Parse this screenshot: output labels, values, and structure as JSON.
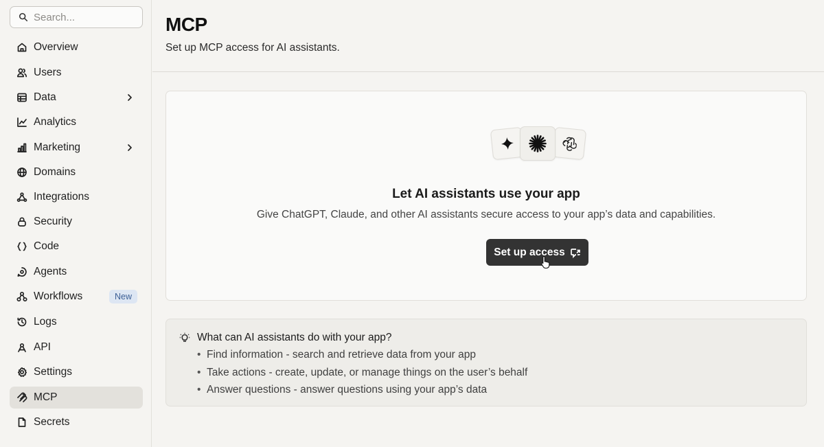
{
  "search": {
    "placeholder": "Search..."
  },
  "sidebar": {
    "items": [
      {
        "label": "Overview",
        "icon": "home-icon"
      },
      {
        "label": "Users",
        "icon": "users-icon"
      },
      {
        "label": "Data",
        "icon": "database-icon",
        "has_submenu": true
      },
      {
        "label": "Analytics",
        "icon": "chart-line-icon"
      },
      {
        "label": "Marketing",
        "icon": "bar-chart-icon",
        "has_submenu": true
      },
      {
        "label": "Domains",
        "icon": "globe-icon"
      },
      {
        "label": "Integrations",
        "icon": "integrations-icon"
      },
      {
        "label": "Security",
        "icon": "lock-icon"
      },
      {
        "label": "Code",
        "icon": "code-braces-icon"
      },
      {
        "label": "Agents",
        "icon": "agent-icon"
      },
      {
        "label": "Workflows",
        "icon": "workflow-icon",
        "badge": "New"
      },
      {
        "label": "Logs",
        "icon": "history-icon"
      },
      {
        "label": "API",
        "icon": "api-icon"
      },
      {
        "label": "Settings",
        "icon": "gear-icon"
      },
      {
        "label": "MCP",
        "icon": "mcp-icon",
        "active": true
      },
      {
        "label": "Secrets",
        "icon": "file-icon"
      }
    ]
  },
  "header": {
    "title": "MCP",
    "subtitle": "Set up MCP access for AI assistants."
  },
  "card": {
    "title": "Let AI assistants use your app",
    "description": "Give ChatGPT, Claude, and other AI assistants secure access to your app’s data and capabilities.",
    "button_label": "Set up access",
    "logos": [
      "gemini-icon",
      "claude-icon",
      "openai-icon"
    ]
  },
  "info": {
    "title": "What can AI assistants do with your app?",
    "items": [
      "Find information - search and retrieve data from your app",
      "Take actions - create, update, or manage things on the user’s behalf",
      "Answer questions - answer questions using your app’s data"
    ]
  },
  "colors": {
    "background": "#f5f4f1",
    "active_item": "#e3e1dc",
    "button": "#333333",
    "badge_bg": "#dde6f3",
    "badge_text": "#3c5f95"
  }
}
